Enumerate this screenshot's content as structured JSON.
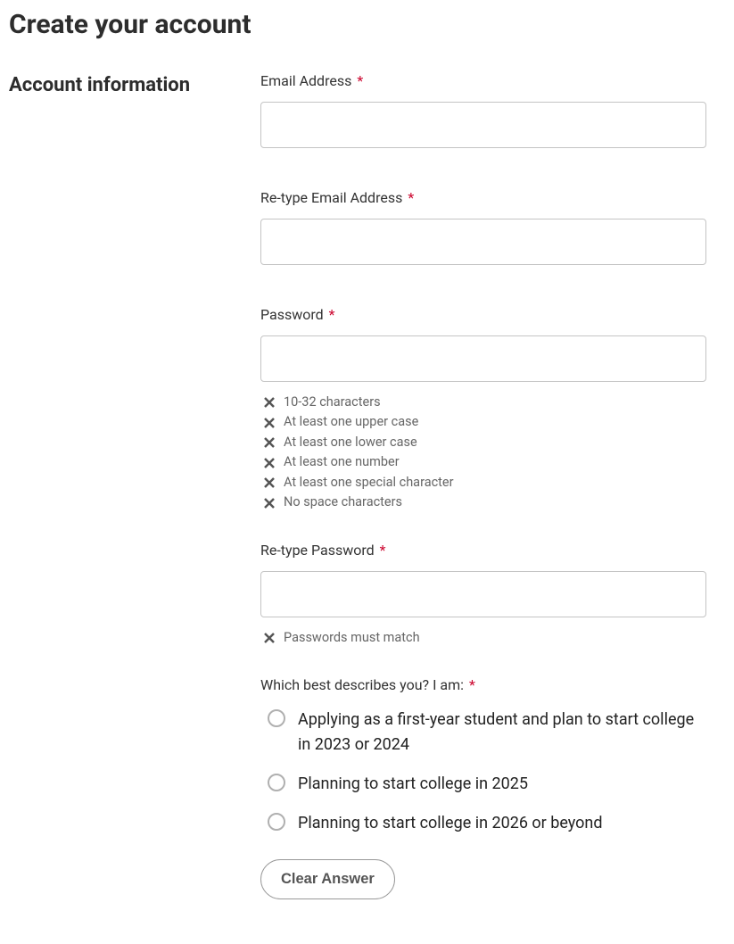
{
  "pageTitle": "Create your account",
  "sectionTitle": "Account information",
  "fields": {
    "email": {
      "label": "Email Address",
      "value": ""
    },
    "retypeEmail": {
      "label": "Re-type Email Address",
      "value": ""
    },
    "password": {
      "label": "Password",
      "value": "",
      "requirements": [
        "10-32 characters",
        "At least one upper case",
        "At least one lower case",
        "At least one number",
        "At least one special character",
        "No space characters"
      ]
    },
    "retypePassword": {
      "label": "Re-type Password",
      "value": "",
      "requirements": [
        "Passwords must match"
      ]
    }
  },
  "describesYou": {
    "label": "Which best describes you? I am:",
    "options": [
      "Applying as a first-year student and plan to start college in 2023 or 2024",
      "Planning to start college in 2025",
      "Planning to start college in 2026 or beyond"
    ],
    "clearLabel": "Clear Answer"
  },
  "requiredMark": "*"
}
